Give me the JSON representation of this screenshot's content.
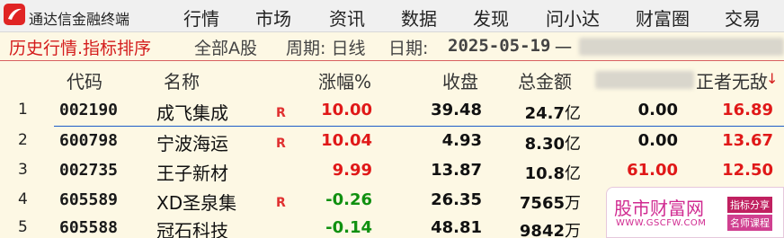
{
  "app": {
    "title": "通达信金融终端",
    "menu": [
      "行情",
      "市场",
      "资讯",
      "数据",
      "发现",
      "问小达",
      "财富圈",
      "交易"
    ]
  },
  "title_line": {
    "main": "历史行情.指标排序",
    "board": "全部A股",
    "period": "周期: 日线",
    "date_label": "日期:",
    "date": "2025-05-19",
    "extra": "一",
    "last_visible_text": "正者无敌"
  },
  "table": {
    "columns": [
      "代码",
      "名称",
      "涨幅%",
      "收盘",
      "总金额"
    ],
    "sort_indicator": "↓",
    "rows": [
      {
        "idx": "1",
        "code": "002190",
        "name": "成飞集成",
        "flag": "R",
        "change": "10.00",
        "close": "39.48",
        "amount": "24.7",
        "amount_unit": "亿",
        "col7": "0.00",
        "col8": "16.89"
      },
      {
        "idx": "2",
        "code": "600798",
        "name": "宁波海运",
        "flag": "R",
        "change": "10.04",
        "close": "4.93",
        "amount": "8.30",
        "amount_unit": "亿",
        "col7": "0.00",
        "col8": "13.67"
      },
      {
        "idx": "3",
        "code": "002735",
        "name": "王子新材",
        "flag": "",
        "change": "9.99",
        "close": "13.87",
        "amount": "10.8",
        "amount_unit": "亿",
        "col7": "61.00",
        "col8": "12.50"
      },
      {
        "idx": "4",
        "code": "605589",
        "name": "XD圣泉集",
        "flag": "R",
        "change": "-0.26",
        "close": "26.35",
        "amount": "7565",
        "amount_unit": "万",
        "col7": "",
        "col8": ""
      },
      {
        "idx": "5",
        "code": "605588",
        "name": "冠石科技",
        "flag": "",
        "change": "-0.14",
        "close": "48.81",
        "amount": "9842",
        "amount_unit": "万",
        "col7": "",
        "col8": ""
      }
    ]
  },
  "watermark": {
    "brand": "股市财富网",
    "url": "WWW.GSCFW.COM",
    "tag1": "指标分享",
    "tag2": "名师课程"
  },
  "colors": {
    "up": "#e01818",
    "down": "#109010",
    "background": "#fdf8e4",
    "title_red": "#d41c1c"
  }
}
